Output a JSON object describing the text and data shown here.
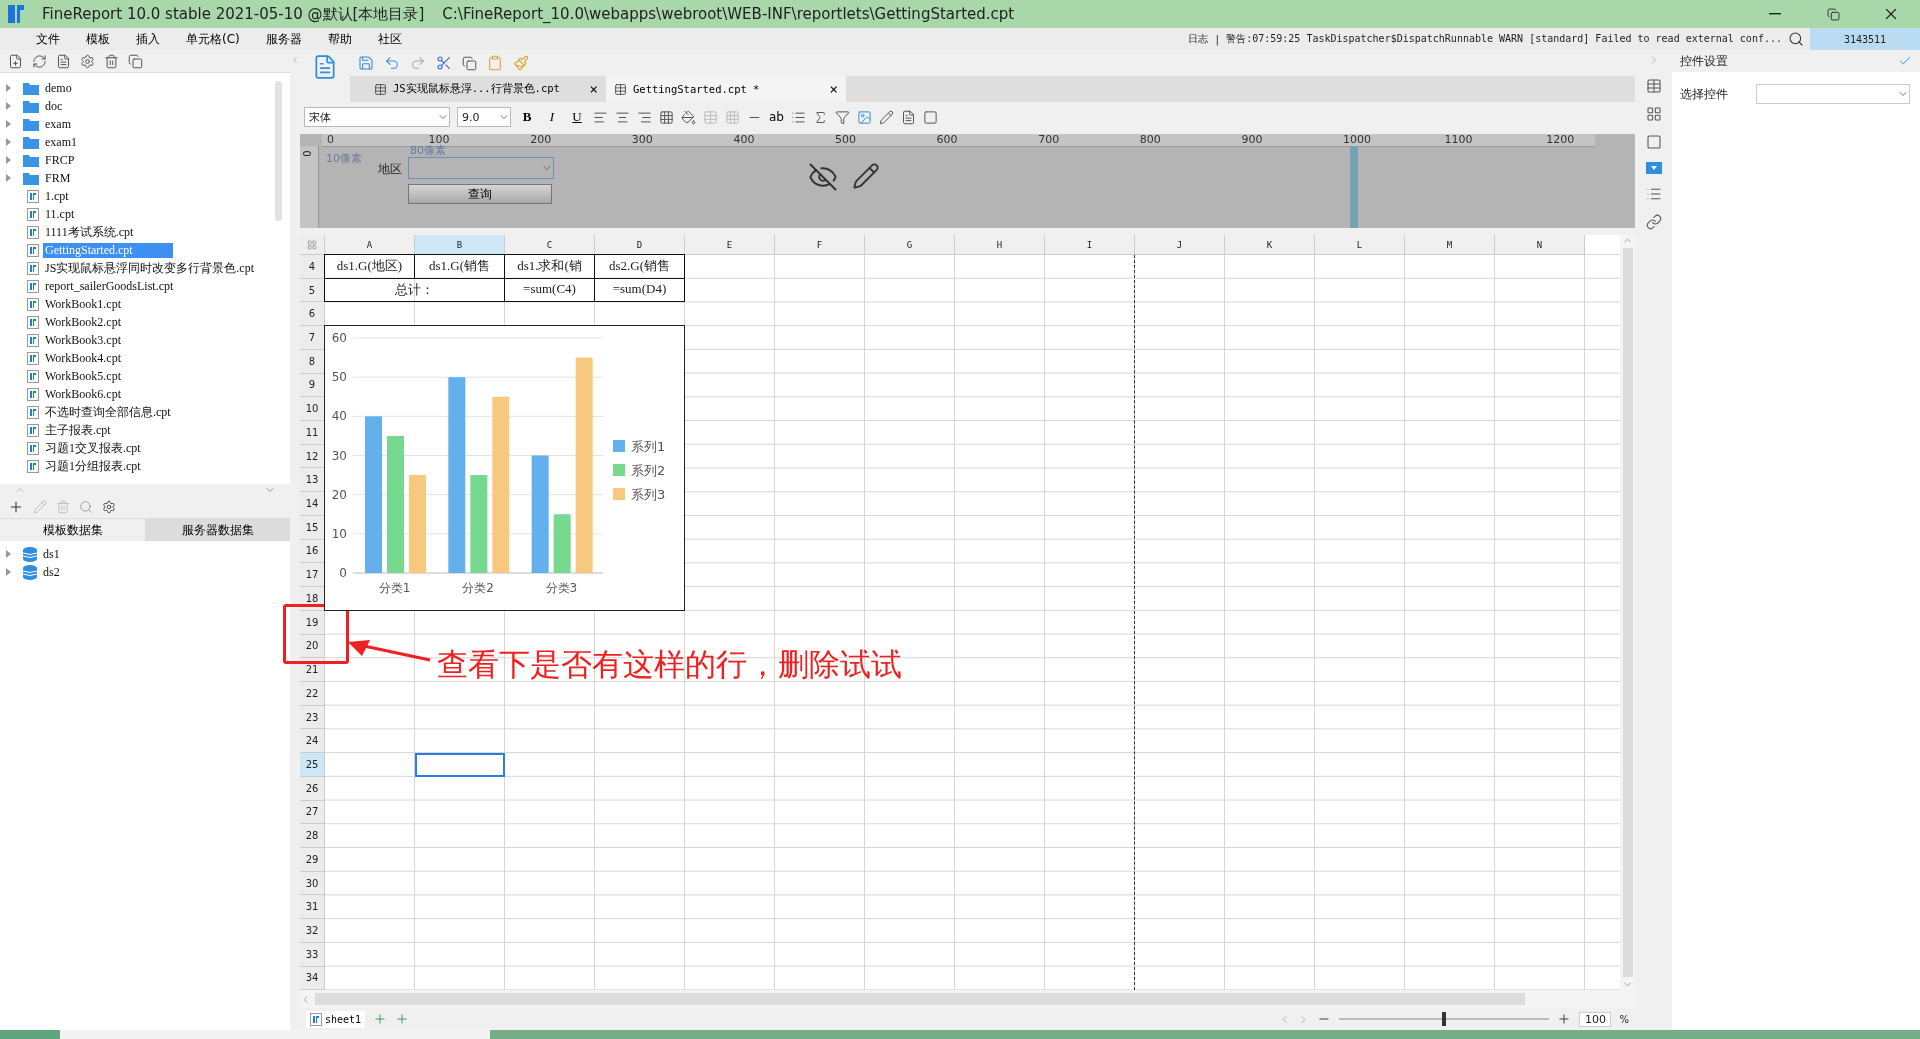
{
  "window": {
    "title": "FineReport 10.0 stable 2021-05-10 @默认[本地目录]",
    "path": "C:\\FineReport_10.0\\webapps\\webroot\\WEB-INF\\reportlets\\GettingStarted.cpt"
  },
  "menu": [
    "文件",
    "模板",
    "插入",
    "单元格(C)",
    "服务器",
    "帮助",
    "社区"
  ],
  "log": {
    "label": "日志",
    "separator": "|",
    "message": "警告:07:59:25 TaskDispatcher$DispatchRunnable WARN [standard] Failed to read external conf...",
    "user": "3143511"
  },
  "file_tree": [
    {
      "kind": "folder",
      "label": "demo",
      "expanded": false
    },
    {
      "kind": "folder",
      "label": "doc",
      "expanded": false
    },
    {
      "kind": "folder",
      "label": "exam",
      "expanded": false
    },
    {
      "kind": "folder",
      "label": "exam1",
      "expanded": false
    },
    {
      "kind": "folder",
      "label": "FRCP",
      "expanded": false
    },
    {
      "kind": "folder",
      "label": "FRM",
      "expanded": false
    },
    {
      "kind": "file",
      "label": "1.cpt",
      "selected": false
    },
    {
      "kind": "file",
      "label": "11.cpt",
      "selected": false
    },
    {
      "kind": "file",
      "label": "1111考试系统.cpt",
      "selected": false
    },
    {
      "kind": "file",
      "label": "GettingStarted.cpt",
      "selected": true
    },
    {
      "kind": "file",
      "label": "JS实现鼠标悬浮同时改变多行背景色.cpt",
      "selected": false
    },
    {
      "kind": "file",
      "label": "report_sailerGoodsList.cpt",
      "selected": false
    },
    {
      "kind": "file",
      "label": "WorkBook1.cpt",
      "selected": false
    },
    {
      "kind": "file",
      "label": "WorkBook2.cpt",
      "selected": false
    },
    {
      "kind": "file",
      "label": "WorkBook3.cpt",
      "selected": false
    },
    {
      "kind": "file",
      "label": "WorkBook4.cpt",
      "selected": false
    },
    {
      "kind": "file",
      "label": "WorkBook5.cpt",
      "selected": false
    },
    {
      "kind": "file",
      "label": "WorkBook6.cpt",
      "selected": false
    },
    {
      "kind": "file",
      "label": "不选时查询全部信息.cpt",
      "selected": false
    },
    {
      "kind": "file",
      "label": "主子报表.cpt",
      "selected": false
    },
    {
      "kind": "file",
      "label": "习题1交叉报表.cpt",
      "selected": false
    },
    {
      "kind": "file",
      "label": "习题1分组报表.cpt",
      "selected": false
    }
  ],
  "dataset_tabs": [
    {
      "label": "模板数据集",
      "selected": true
    },
    {
      "label": "服务器数据集",
      "selected": false
    }
  ],
  "datasets": [
    {
      "label": "ds1",
      "expanded": false
    },
    {
      "label": "ds2",
      "expanded": false
    }
  ],
  "editor_tabs": [
    {
      "label": "JS实现鼠标悬浮...行背景色.cpt",
      "close": "×",
      "selected": false
    },
    {
      "label": "GettingStarted.cpt *",
      "close": "×",
      "selected": true
    }
  ],
  "format_bar": {
    "font": "宋体",
    "size": "9.0",
    "styles": [
      "B",
      "I",
      "U"
    ],
    "wrap": "ab"
  },
  "parameter_pane": {
    "ruler": [
      "0",
      "100",
      "200",
      "300",
      "400",
      "500",
      "600",
      "700",
      "800",
      "900",
      "1000",
      "1100",
      "1200"
    ],
    "vertical_ruler": "0",
    "margin_left": "10像素",
    "margin_top": "80像素",
    "field_label": "地区",
    "button": "查询"
  },
  "sheet": {
    "columns": [
      {
        "label": "A",
        "selected": false
      },
      {
        "label": "B",
        "selected": true
      },
      {
        "label": "C",
        "selected": false
      },
      {
        "label": "D",
        "selected": false
      },
      {
        "label": "E",
        "selected": false
      },
      {
        "label": "F",
        "selected": false
      },
      {
        "label": "G",
        "selected": false
      },
      {
        "label": "H",
        "selected": false
      },
      {
        "label": "I",
        "selected": false
      },
      {
        "label": "J",
        "selected": false
      },
      {
        "label": "K",
        "selected": false
      },
      {
        "label": "L",
        "selected": false
      },
      {
        "label": "M",
        "selected": false
      },
      {
        "label": "N",
        "selected": false
      }
    ],
    "rows": [
      {
        "label": "4",
        "selected": false,
        "cells": [
          {
            "kind": "single",
            "text": "ds1.G(地区)",
            "selected": false
          },
          {
            "kind": "single",
            "text": "ds1.G(销售",
            "selected": false
          },
          {
            "kind": "single",
            "text": "ds1.求和(销",
            "selected": false
          },
          {
            "kind": "single",
            "text": "ds2.G(销售",
            "selected": false
          }
        ]
      },
      {
        "label": "5",
        "selected": false,
        "cells": [
          {
            "kind": "merged",
            "text": "总计：",
            "selected": false
          },
          {
            "kind": "single",
            "text": "=sum(C4)",
            "selected": false
          },
          {
            "kind": "single",
            "text": "=sum(D4)",
            "selected": false
          }
        ]
      },
      {
        "label": "6",
        "selected": false
      },
      {
        "label": "7",
        "selected": false
      },
      {
        "label": "8",
        "selected": false
      },
      {
        "label": "9",
        "selected": false
      },
      {
        "label": "10",
        "selected": false
      },
      {
        "label": "11",
        "selected": false
      },
      {
        "label": "12",
        "selected": false
      },
      {
        "label": "13",
        "selected": false
      },
      {
        "label": "14",
        "selected": false
      },
      {
        "label": "15",
        "selected": false
      },
      {
        "label": "16",
        "selected": false
      },
      {
        "label": "17",
        "selected": false
      },
      {
        "label": "18",
        "selected": false
      },
      {
        "label": "19",
        "selected": false
      },
      {
        "label": "20",
        "selected": false
      },
      {
        "label": "21",
        "selected": false
      },
      {
        "label": "22",
        "selected": false
      },
      {
        "label": "23",
        "selected": false
      },
      {
        "label": "24",
        "selected": false
      },
      {
        "label": "25",
        "selected": true,
        "cells": [
          {
            "kind": "single",
            "selected": false
          },
          {
            "kind": "single",
            "selected": true
          }
        ]
      },
      {
        "label": "26",
        "selected": false
      },
      {
        "label": "27",
        "selected": false
      },
      {
        "label": "28",
        "selected": false
      },
      {
        "label": "29",
        "selected": false
      },
      {
        "label": "30",
        "selected": false
      },
      {
        "label": "31",
        "selected": false
      },
      {
        "label": "32",
        "selected": false
      },
      {
        "label": "33",
        "selected": false
      },
      {
        "label": "34",
        "selected": false
      }
    ]
  },
  "chart": {
    "chart_data": {
      "type": "bar",
      "categories": [
        "分类1",
        "分类2",
        "分类3"
      ],
      "series": [
        {
          "name": "系列1",
          "color": "#64b0ec",
          "values": [
            40,
            50,
            30
          ]
        },
        {
          "name": "系列2",
          "color": "#76d98f",
          "values": [
            35,
            25,
            15
          ]
        },
        {
          "name": "系列3",
          "color": "#f7c97e",
          "values": [
            25,
            45,
            55
          ]
        }
      ],
      "ylim": [
        0,
        60
      ],
      "yticks": [
        0,
        10,
        20,
        30,
        40,
        50,
        60
      ],
      "grid": true,
      "legend": "right"
    }
  },
  "annotation": {
    "text": "查看下是否有这样的行，删除试试"
  },
  "widget_panel": {
    "title": "控件设置",
    "select_label": "选择控件"
  },
  "sheet_tabs": [
    {
      "label": "sheet1",
      "selected": true
    }
  ],
  "zoom": {
    "level": 0.5,
    "value": "100",
    "unit": "%"
  }
}
